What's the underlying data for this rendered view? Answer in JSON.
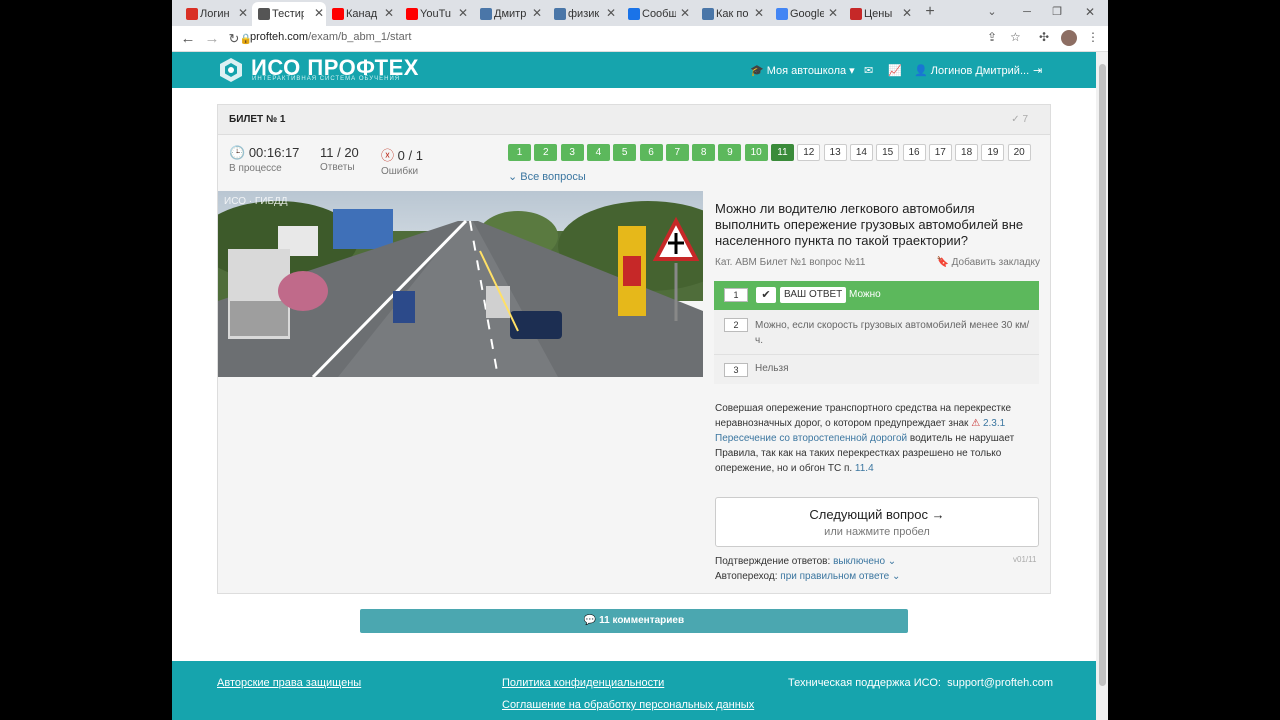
{
  "browser": {
    "tabs": [
      {
        "label": "Логин",
        "fav_color": "#d93025"
      },
      {
        "label": "Тестир",
        "fav_color": "#555555"
      },
      {
        "label": "Канад",
        "fav_color": "#ff0000"
      },
      {
        "label": "YouTu",
        "fav_color": "#ff0000"
      },
      {
        "label": "Дмитр",
        "fav_color": "#4a76a8"
      },
      {
        "label": "физик",
        "fav_color": "#4a76a8"
      },
      {
        "label": "Сообщ",
        "fav_color": "#1a73e8"
      },
      {
        "label": "Как по",
        "fav_color": "#4a76a8"
      },
      {
        "label": "Google",
        "fav_color": "#4285f4"
      },
      {
        "label": "Цены",
        "fav_color": "#c62828"
      }
    ],
    "new_tab": "+",
    "url_host": "profteh.com",
    "url_path": "/exam/b_abm_1/start"
  },
  "site": {
    "logo_title": "ИСО ПРОФТЕХ",
    "logo_subtitle": "ИНТЕРАКТИВНАЯ СИСТЕМА ОБУЧЕНИЯ",
    "nav_school": "Моя автошкола",
    "nav_user": "Логинов Дмитрий..."
  },
  "exam": {
    "ticket_title": "БИЛЕТ № 1",
    "ticket_counter": "7",
    "timer": "00:16:17",
    "timer_label": "В процессе",
    "answers": "11 / 20",
    "answers_label": "Ответы",
    "errors": "0 / 1",
    "errors_label": "Ошибки",
    "questions": [
      {
        "n": "1",
        "state": "done"
      },
      {
        "n": "2",
        "state": "done"
      },
      {
        "n": "3",
        "state": "done"
      },
      {
        "n": "4",
        "state": "done"
      },
      {
        "n": "5",
        "state": "done"
      },
      {
        "n": "6",
        "state": "done"
      },
      {
        "n": "7",
        "state": "done"
      },
      {
        "n": "8",
        "state": "done"
      },
      {
        "n": "9",
        "state": "done"
      },
      {
        "n": "10",
        "state": "done"
      },
      {
        "n": "11",
        "state": "cur"
      },
      {
        "n": "12",
        "state": "todo"
      },
      {
        "n": "13",
        "state": "todo"
      },
      {
        "n": "14",
        "state": "todo"
      },
      {
        "n": "15",
        "state": "todo"
      },
      {
        "n": "16",
        "state": "todo"
      },
      {
        "n": "17",
        "state": "todo"
      },
      {
        "n": "18",
        "state": "todo"
      },
      {
        "n": "19",
        "state": "todo"
      },
      {
        "n": "20",
        "state": "todo"
      }
    ],
    "all_questions": "Все вопросы",
    "photo_watermark": "ИСО · ГИБДД",
    "question_text": "Можно ли водителю легкового автомобиля выполнить опережение грузовых автомобилей вне населенного пункта по такой траектории?",
    "question_meta": "Кат. ABM   Билет №1   вопрос №11",
    "bookmark": "Добавить закладку",
    "answer_list": [
      {
        "num": "1",
        "text": "Можно",
        "badge": "ВАШ ОТВЕТ"
      },
      {
        "num": "2",
        "text": "Можно, если скорость грузовых автомобилей менее 30 км/ч."
      },
      {
        "num": "3",
        "text": "Нельзя"
      }
    ],
    "explanation_1": "Совершая опережение транспортного средства на перекрестке неравнозначных дорог, о котором предупреждает знак",
    "explanation_sign": "2.3.1",
    "explanation_link": "Пересечение со второстепенной дорогой",
    "explanation_2": "водитель не нарушает Правила, так как на таких перекрестках разрешено не только опережение, но и обгон ТС п.",
    "explanation_rule": "11.4",
    "next_button": "Следующий вопрос →",
    "next_hint": "или нажмите пробел",
    "confirm_label": "Подтверждение ответов:",
    "confirm_value": "выключено",
    "autoadvance_label": "Автопереход:",
    "autoadvance_value": "при правильном ответе",
    "version": "v01/11",
    "comments": "11 комментариев"
  },
  "footer": {
    "copyright": "Авторские права защищены",
    "privacy": "Политика конфиденциальности",
    "agreement": "Соглашение на обработку персональных данных",
    "support_label": "Техническая поддержка ИСО:",
    "support_email": "support@profteh.com"
  },
  "colors": {
    "brand": "#16a4ad",
    "correct": "#5cb85c",
    "current": "#3a8b3a",
    "link": "#3b76a0"
  }
}
